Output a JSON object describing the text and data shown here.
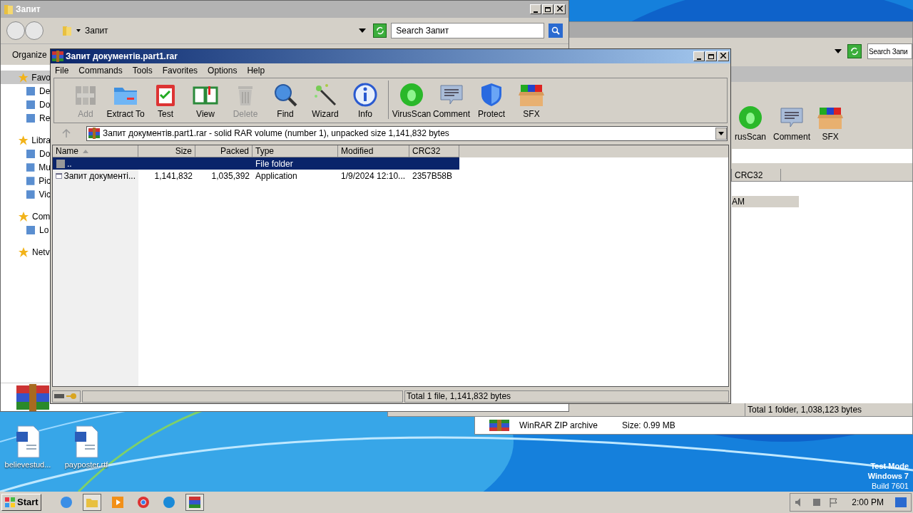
{
  "explorer_window": {
    "title": "Запит",
    "address": "Запит",
    "search_placeholder": "Search Запит",
    "toolbar": [
      "Organize"
    ],
    "nav": [
      {
        "label": "Favo",
        "selected": true,
        "children": [
          {
            "label": "De",
            "selected": false
          },
          {
            "label": "Do",
            "selected": false
          },
          {
            "label": "Re",
            "selected": false
          }
        ]
      },
      {
        "label": "Libra",
        "selected": false,
        "children": [
          {
            "label": "Do",
            "selected": false
          },
          {
            "label": "Mu",
            "selected": false
          },
          {
            "label": "Pic",
            "selected": false
          },
          {
            "label": "Vic",
            "selected": false
          }
        ]
      },
      {
        "label": "Com",
        "selected": false,
        "children": [
          {
            "label": "Lo",
            "selected": false
          }
        ]
      },
      {
        "label": "Netv",
        "selected": false
      }
    ]
  },
  "background_window": {
    "search_placeholder": "Search Запи",
    "toolbar": [
      "rusScan",
      "Comment",
      "SFX"
    ],
    "column": "CRC32",
    "row_text": "AM",
    "status": "Total 1 folder, 1,038,123 bytes",
    "details": [
      "WinRAR ZIP archive",
      "Size: 0.99 MB"
    ]
  },
  "winrar_window": {
    "title": "Запит документів.part1.rar",
    "menu": [
      "File",
      "Commands",
      "Tools",
      "Favorites",
      "Options",
      "Help"
    ],
    "toolbar": [
      {
        "label": "Add",
        "disabled": true
      },
      {
        "label": "Extract To",
        "disabled": false
      },
      {
        "label": "Test",
        "disabled": false
      },
      {
        "label": "View",
        "disabled": false
      },
      {
        "label": "Delete",
        "disabled": true
      },
      {
        "label": "Find",
        "disabled": false
      },
      {
        "label": "Wizard",
        "disabled": false
      },
      {
        "label": "Info",
        "disabled": false
      },
      {
        "label": "VirusScan",
        "disabled": false
      },
      {
        "label": "Comment",
        "disabled": false
      },
      {
        "label": "Protect",
        "disabled": false
      },
      {
        "label": "SFX",
        "disabled": false
      }
    ],
    "path": "Запит документів.part1.rar - solid RAR volume (number 1), unpacked size 1,141,832 bytes",
    "columns": [
      "Name",
      "Size",
      "Packed",
      "Type",
      "Modified",
      "CRC32"
    ],
    "rows": [
      {
        "kind": "folder",
        "selected": true,
        "name": "..",
        "size": "",
        "packed": "",
        "type": "File folder",
        "modified": "",
        "crc": ""
      },
      {
        "kind": "file",
        "selected": false,
        "name": "Запит документі...",
        "size": "1,141,832",
        "packed": "1,035,392",
        "type": "Application",
        "modified": "1/9/2024 12:10...",
        "crc": "2357B58B"
      }
    ],
    "status": "Total 1 file, 1,141,832 bytes"
  },
  "desktop": {
    "icons": [
      "believestud...",
      "payposter.rtf"
    ],
    "os_notice": [
      "Test Mode",
      "Windows 7",
      "Build 7601"
    ]
  },
  "taskbar": {
    "start": "Start",
    "clock": "2:00 PM"
  }
}
